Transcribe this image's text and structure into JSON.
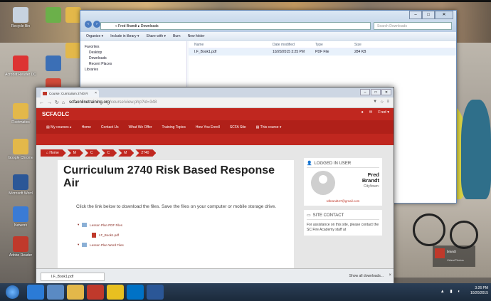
{
  "explorer": {
    "path": "« Fred Brandt ▸ Downloads",
    "search_placeholder": "Search Downloads",
    "toolbar": [
      "Organize ▾",
      "Include in library ▾",
      "Share with ▾",
      "Burn",
      "New folder"
    ],
    "nav": [
      "Favorites",
      "Desktop",
      "Downloads",
      "Recent Places",
      "",
      "Libraries"
    ],
    "columns": [
      "Name",
      "Date modified",
      "Type",
      "Size"
    ],
    "file": {
      "name": "I.F_Book1.pdf",
      "date": "10/20/2015 3:25 PM",
      "type": "PDF File",
      "size": "284 KB"
    }
  },
  "browser": {
    "tab_title": "Course: Curriculum 2740 R",
    "url_host": "scfaonlinetraining.org",
    "url_path": "/course/view.php?id=348"
  },
  "site": {
    "brand": "SCFAOLC",
    "user_menu": "Fred ▾",
    "nav": [
      "▤ My courses ▸",
      "Home",
      "Contact Us",
      "What We Offer",
      "Training Topics",
      "How You Enroll",
      "SCFA Site",
      "▤ This course ▾"
    ],
    "breadcrumbs": [
      "⌂ Home",
      "M",
      "C",
      "C",
      "M",
      "2740"
    ],
    "course_title": "Curriculum 2740 Risk Based Response Air",
    "instructions": "Click the link below to download the files. Save the files on your computer or mobile storage drive.",
    "files": {
      "folder1": "Lesson Plan PDF Files",
      "file1": "I.F_Book1.pdf",
      "folder2": "Lesson Plan Word Files"
    },
    "logged_in": {
      "heading": "LOGGED IN USER",
      "first": "Fred",
      "last": "Brandt",
      "city": "City/town:",
      "email": "rdbrandt47@gmail.com"
    },
    "contact": {
      "heading": "SITE CONTACT",
      "text": "For assistance on this site, please contact the SC Fire Academy staff at"
    }
  },
  "downloads": {
    "item": "I.F_Book1.pdf",
    "show_all": "Show all downloads...",
    "close": "×"
  },
  "desktop_icons": [
    "Recycle Bin",
    "Acrobat Reader DC",
    "Fleetmatics",
    "Google Chrome",
    "Microsoft Word",
    "Network",
    "Adobe Reader"
  ],
  "chat": {
    "name": "brandt",
    "sub": "Video/Photos"
  },
  "clock": {
    "time": "3:26 PM",
    "date": "10/20/2015"
  }
}
